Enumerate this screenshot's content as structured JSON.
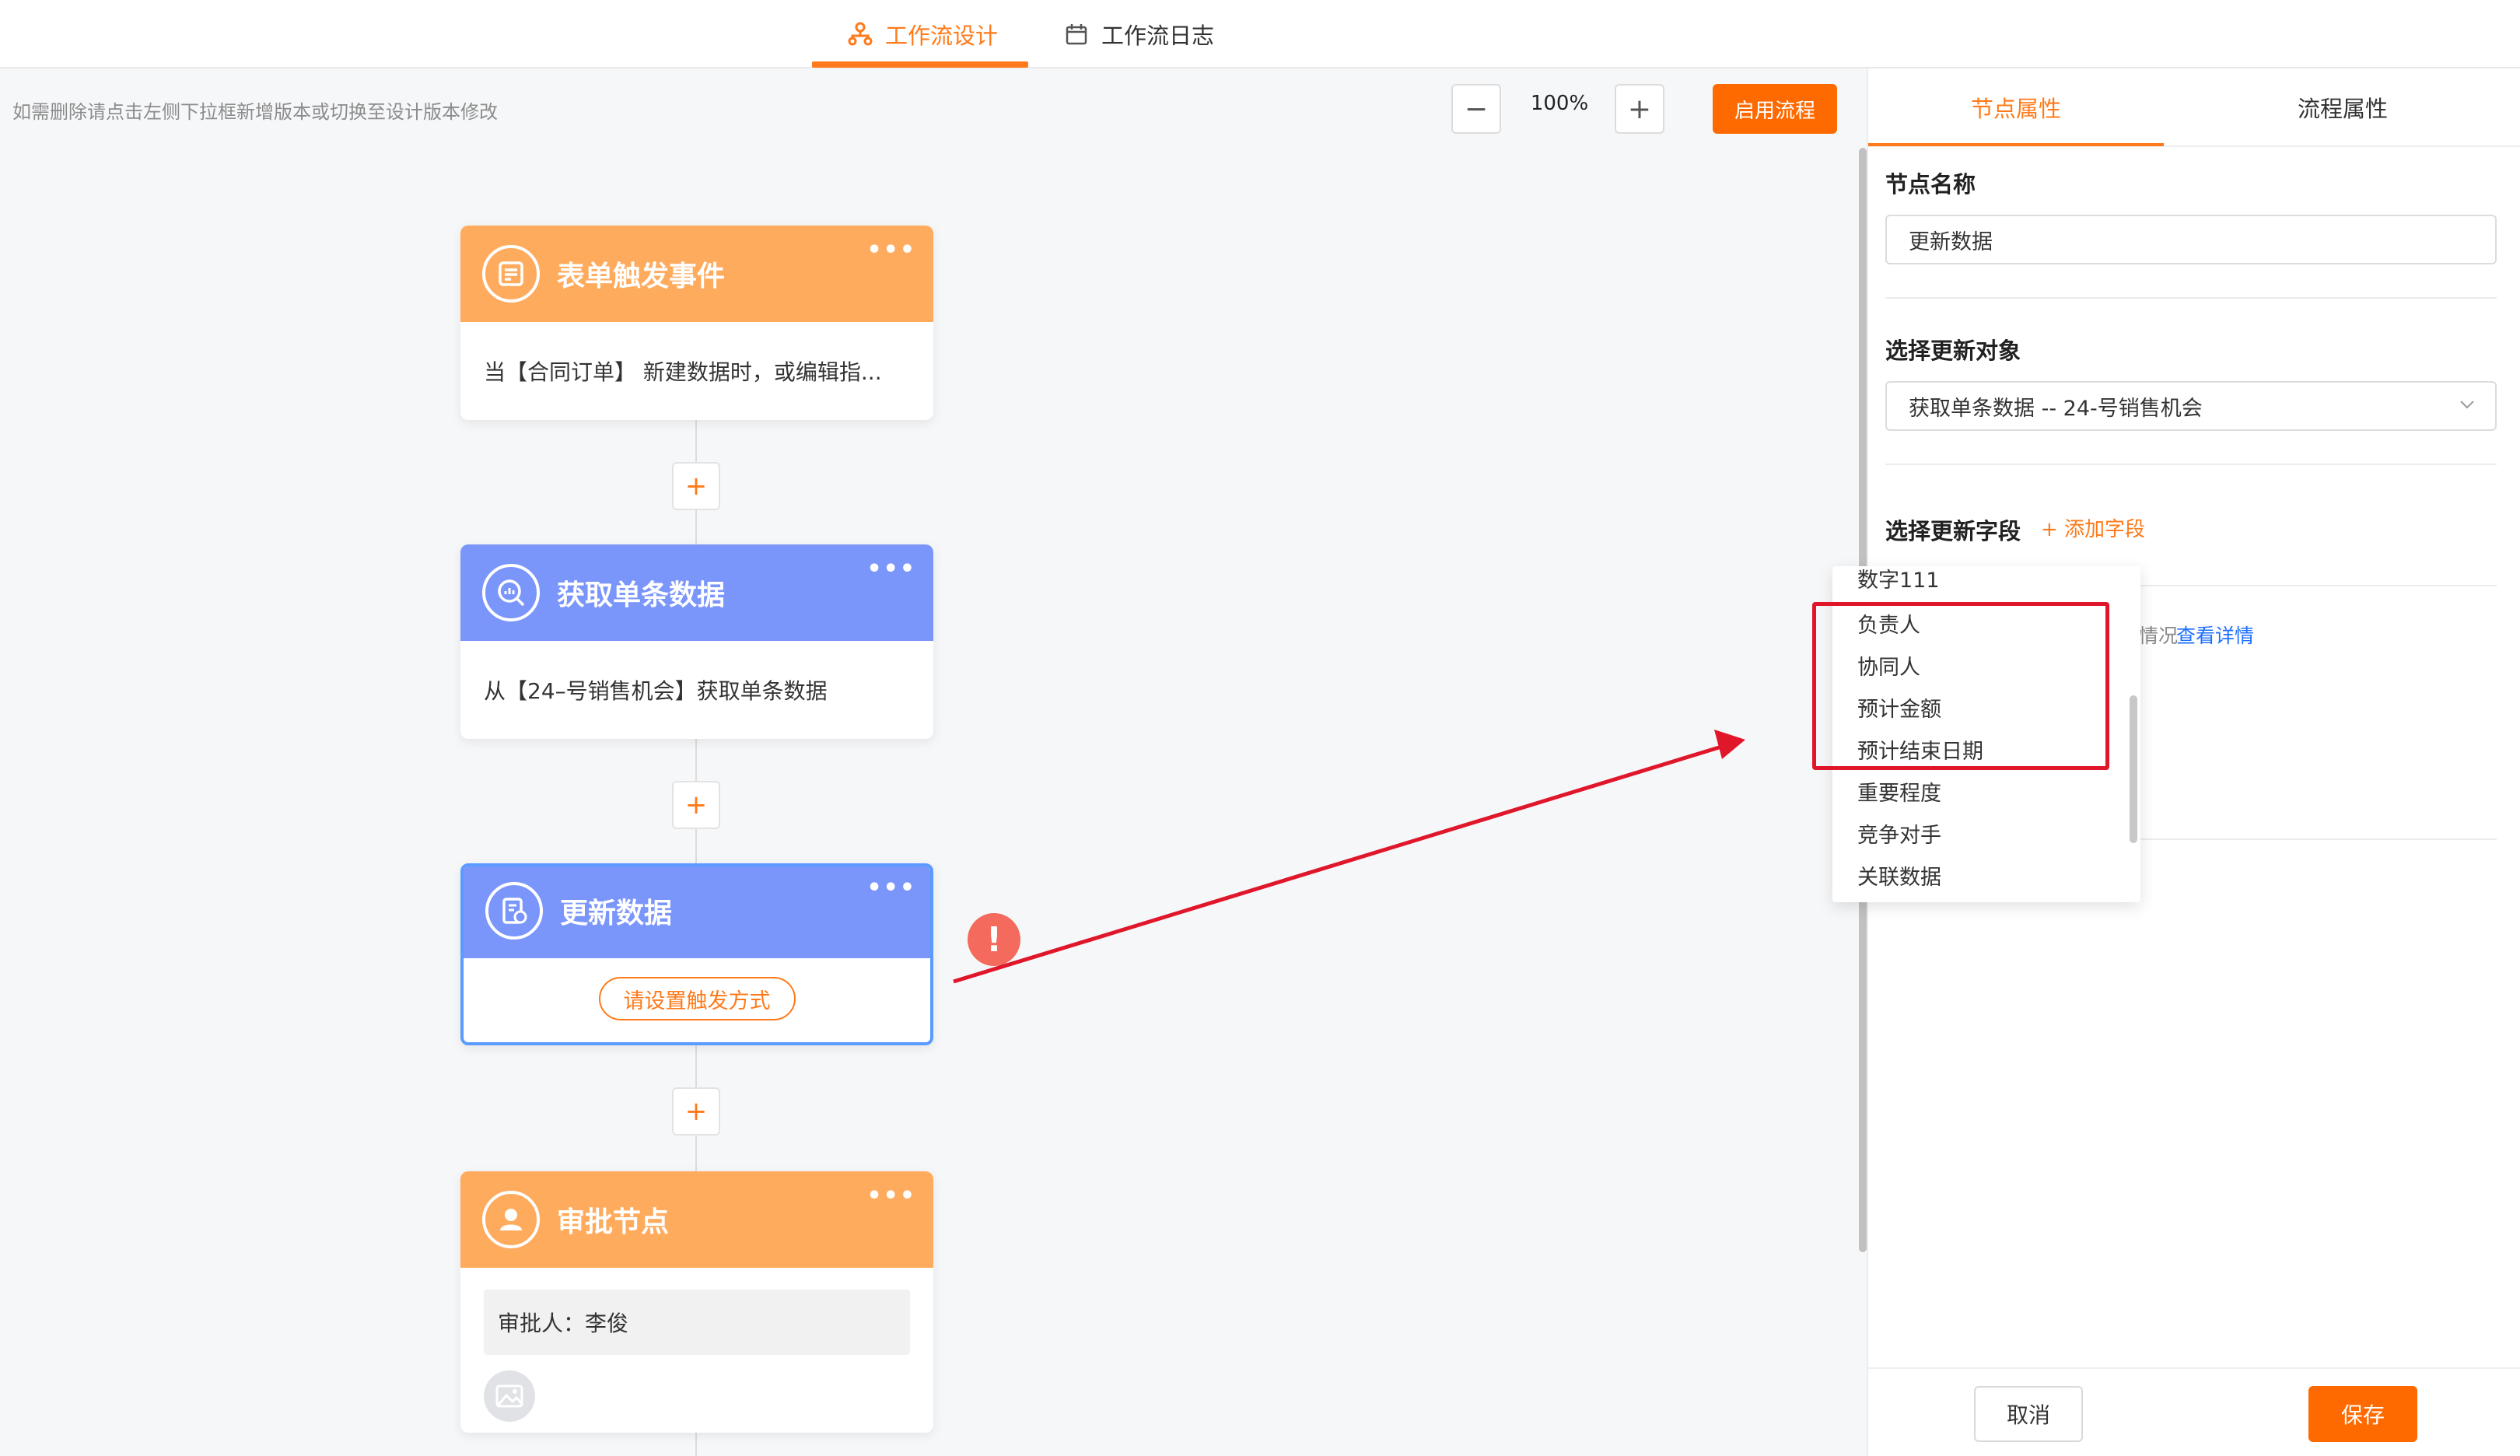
{
  "tabs": [
    {
      "label": "工作流设计",
      "icon": "workflow-icon",
      "active": true
    },
    {
      "label": "工作流日志",
      "icon": "calendar-icon",
      "active": false
    }
  ],
  "toolbar": {
    "hint": "如需删除请点击左侧下拉框新增版本或切换至设计版本修改",
    "zoom_out": "−",
    "zoom_value": "100%",
    "zoom_in": "+",
    "enable_label": "启用流程"
  },
  "nodes": [
    {
      "title": "表单触发事件",
      "body": "当【合同订单】 新建数据时，或编辑指...",
      "color": "#ffab5e",
      "icon": "form-icon"
    },
    {
      "title": "获取单条数据",
      "body": "从【24–号销售机会】获取单条数据",
      "color": "#7b96fb",
      "icon": "search-data-icon"
    },
    {
      "title": "更新数据",
      "trigger_label": "请设置触发方式",
      "color": "#7b96fb",
      "icon": "update-data-icon"
    },
    {
      "title": "审批节点",
      "approver": "审批人：李俊",
      "color": "#ffab5e",
      "icon": "user-icon"
    }
  ],
  "canvas": {
    "add_symbol": "+",
    "more_symbol": "•••",
    "warning_symbol": "!"
  },
  "panel": {
    "tabs": [
      "节点属性",
      "流程属性"
    ],
    "node_name_label": "节点名称",
    "node_name_value": "更新数据",
    "target_label": "选择更新对象",
    "target_value": "获取单条数据 -- 24-号销售机会",
    "fields_label": "选择更新字段",
    "add_field_label": "+ 添加字段",
    "partial_text": "情况",
    "detail_link": "查看详情",
    "cancel_label": "取消",
    "save_label": "保存"
  },
  "dropdown": {
    "items": [
      "数字111",
      "负责人",
      "协同人",
      "预计金额",
      "预计结束日期",
      "重要程度",
      "竞争对手",
      "关联数据"
    ]
  },
  "colors": {
    "accent": "#ff6a00",
    "annotation": "#e0162b",
    "link": "#1e6fff"
  }
}
